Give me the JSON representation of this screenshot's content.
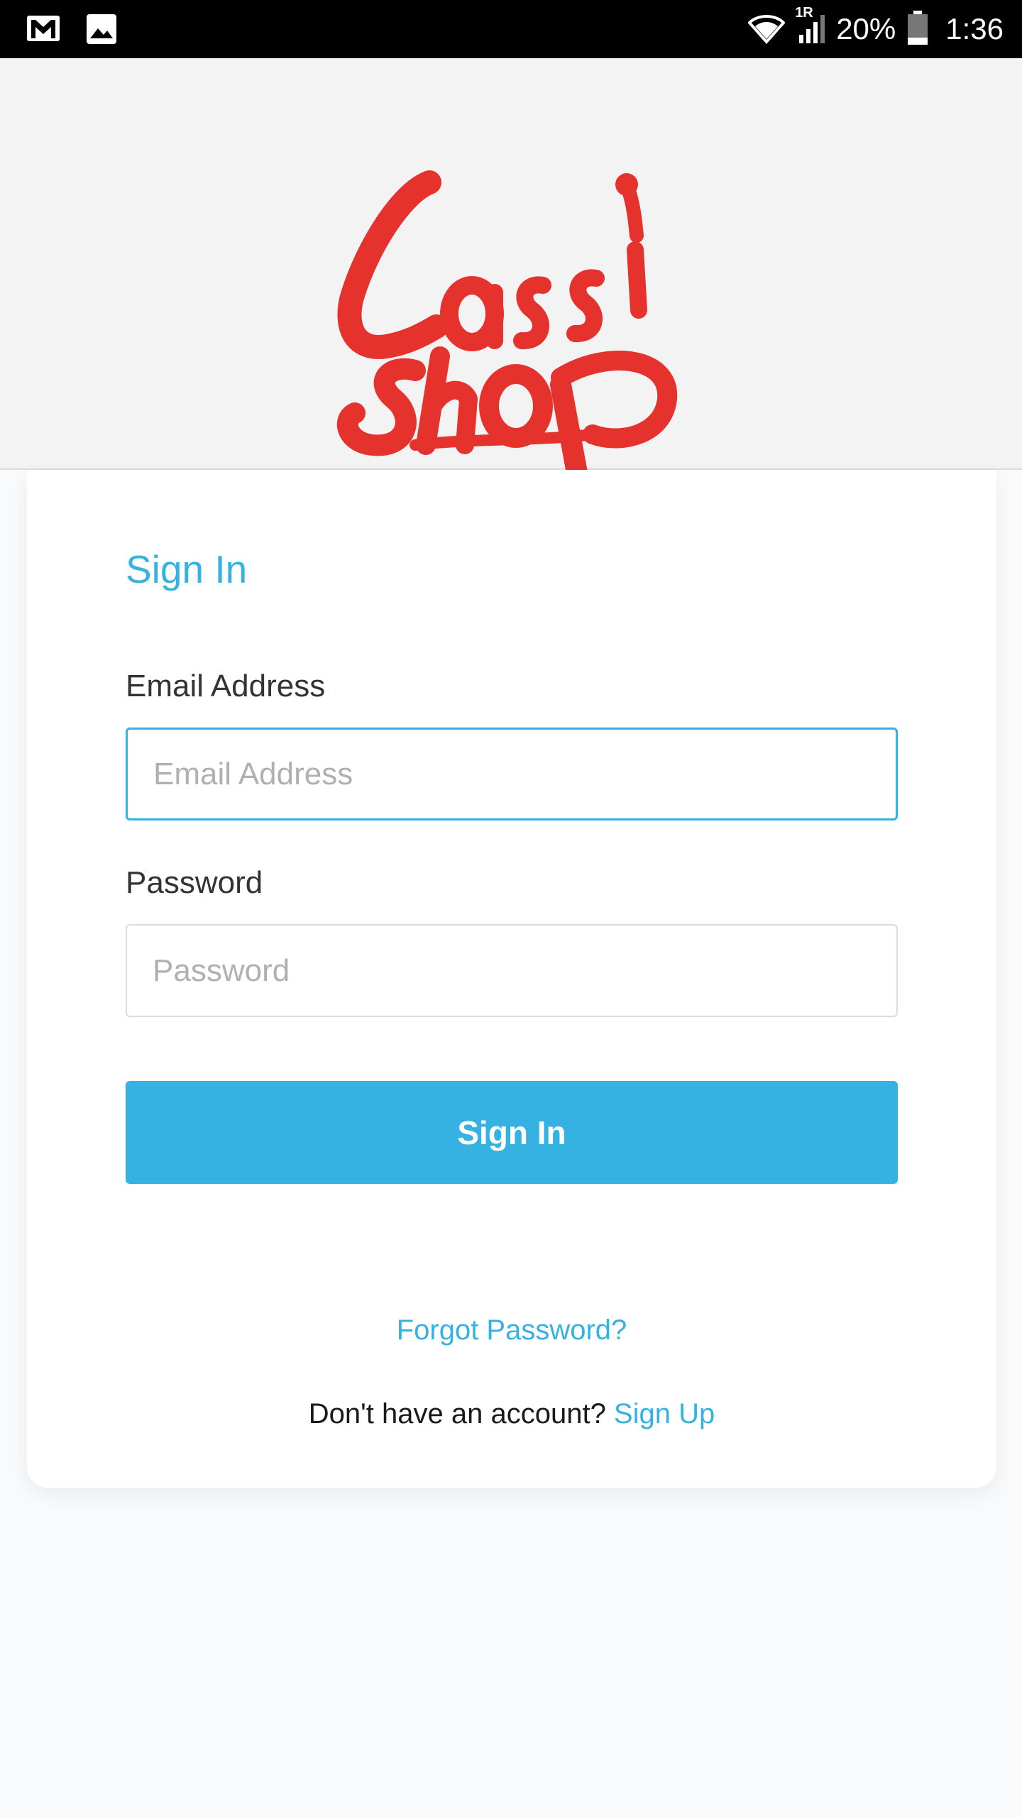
{
  "status_bar": {
    "icons": [
      "gmail-icon",
      "image-icon",
      "wifi-icon",
      "signal-icon",
      "battery-icon"
    ],
    "network_label": "1R",
    "battery": "20%",
    "time": "1:36"
  },
  "brand": {
    "logo_text": "Lassi shop",
    "logo_color": "#e5322d"
  },
  "form": {
    "title": "Sign In",
    "email": {
      "label": "Email Address",
      "placeholder": "Email Address",
      "value": ""
    },
    "password": {
      "label": "Password",
      "placeholder": "Password",
      "value": ""
    },
    "submit_label": "Sign In",
    "forgot_label": "Forgot Password?",
    "signup_prompt": "Don't have an account? ",
    "signup_label": "Sign Up"
  },
  "colors": {
    "accent": "#36b2e2",
    "header_bg": "#f4f3f4",
    "page_bg": "#f9fafc"
  }
}
